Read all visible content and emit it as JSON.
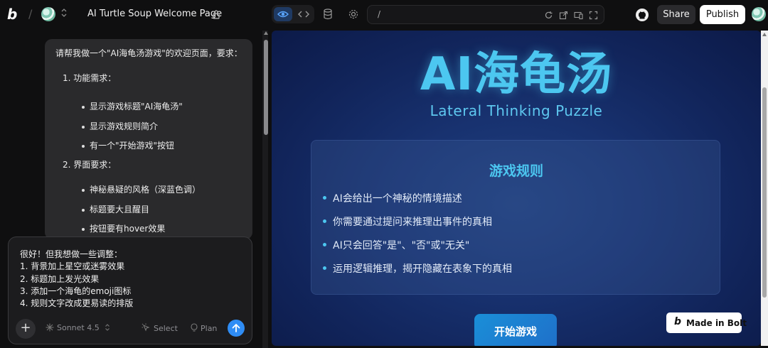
{
  "topbar": {
    "logo": "b",
    "project_title": "AI Turtle Soup Welcome Page",
    "url": "/",
    "share_label": "Share",
    "publish_label": "Publish"
  },
  "chat": {
    "request_lines": [
      "请帮我做一个\"AI海龟汤游戏\"的欢迎页面，要求：",
      "1. 功能需求：",
      "显示游戏标题\"AI海龟汤\"",
      "显示游戏规则简介",
      "有一个\"开始游戏\"按钮",
      "2. 界面要求：",
      "神秘悬疑的风格（深蓝色调）",
      "标题要大且醒目",
      "按钮要有hover效果"
    ],
    "composer_text": "很好！但我想做一些调整：\n1. 背景加上星空或迷雾效果\n2. 标题加上发光效果\n3. 添加一个海龟的emoji图标\n4. 规则文字改成更易读的排版",
    "model_label": "Sonnet 4.5",
    "select_label": "Select",
    "plan_label": "Plan"
  },
  "preview": {
    "title": "AI海龟汤",
    "subtitle": "Lateral Thinking Puzzle",
    "rules_title": "游戏规则",
    "rules": [
      "AI会给出一个神秘的情境描述",
      "你需要通过提问来推理出事件的真相",
      "AI只会回答\"是\"、\"否\"或\"无关\"",
      "运用逻辑推理，揭开隐藏在表象下的真相"
    ],
    "start_button": "开始游戏",
    "badge": "Made in Bolt",
    "badge_logo": "b"
  },
  "colors": {
    "accent_blue": "#2f8df5",
    "title_cyan": "#4cc7f0",
    "preview_bg": "#11245a"
  }
}
